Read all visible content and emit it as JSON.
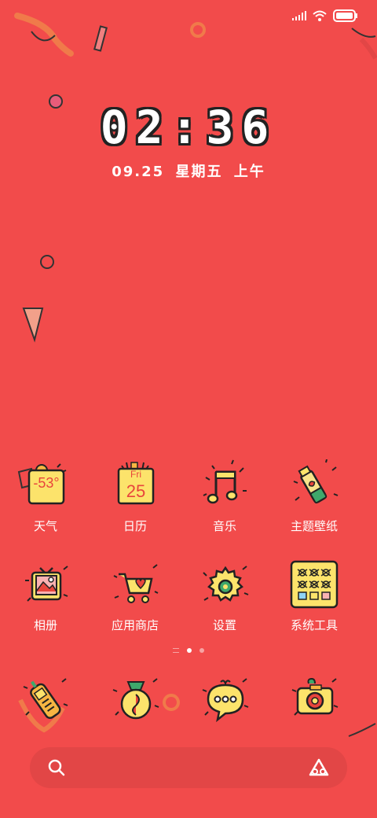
{
  "clock": {
    "time": "02:36"
  },
  "date": {
    "day": "09.25",
    "weekday": "星期五",
    "period": "上午"
  },
  "weather_widget": {
    "temp": "-53°"
  },
  "calendar_widget": {
    "weekday": "Fri",
    "day": "25"
  },
  "apps_row1": [
    {
      "label": "天气",
      "icon": "weather-icon"
    },
    {
      "label": "日历",
      "icon": "calendar-icon"
    },
    {
      "label": "音乐",
      "icon": "music-icon"
    },
    {
      "label": "主题壁纸",
      "icon": "theme-icon"
    }
  ],
  "apps_row2": [
    {
      "label": "相册",
      "icon": "gallery-icon"
    },
    {
      "label": "应用商店",
      "icon": "app-store-icon"
    },
    {
      "label": "设置",
      "icon": "settings-icon"
    },
    {
      "label": "系统工具",
      "icon": "system-tools-folder-icon"
    }
  ],
  "dock": [
    {
      "icon": "phone-icon"
    },
    {
      "icon": "browser-icon"
    },
    {
      "icon": "messages-icon"
    },
    {
      "icon": "camera-icon"
    }
  ],
  "page_indicator": {
    "pages": 3,
    "current": 2
  },
  "colors": {
    "background": "#F24B4B",
    "icon_yellow": "#FCE36B",
    "outline": "#222222",
    "accent_red": "#E8453C"
  }
}
